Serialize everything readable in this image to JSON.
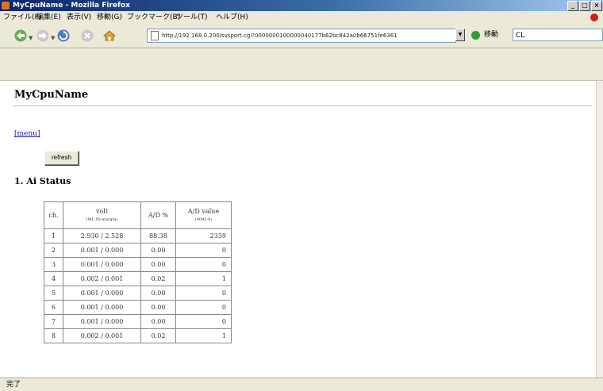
{
  "window": {
    "title": "MyCpuName - Mozilla Firefox"
  },
  "menu": [
    "ファイル(F)",
    "編集(E)",
    "表示(V)",
    "移動(G)",
    "ブックマーク(B)",
    "ツール(T)",
    "ヘルプ(H)"
  ],
  "nav": {
    "url": "http://192.168.0.200/svsport.cgi?0000000100000040177b62bc842a0b66751fe6361",
    "go_label": "移動",
    "search_value": "CL"
  },
  "page": {
    "title": "MyCpuName",
    "menu_link": "[menu]",
    "refresh_label": "refresh",
    "section_heading": "1. Ai Status",
    "table": {
      "headers": {
        "ch": "ch.",
        "volt": "volt",
        "volt_sub": "(ML Ni-margin)",
        "ad_pct": "A/D %",
        "ad_value": "A/D value",
        "ad_value_sub": "(4095-0)"
      },
      "rows": [
        {
          "ch": "1",
          "volt": "2.930 / 2.528",
          "ad_pct": "88.38",
          "ad_value": "2359"
        },
        {
          "ch": "2",
          "volt": "0.001 / 0.000",
          "ad_pct": "0.00",
          "ad_value": "0"
        },
        {
          "ch": "3",
          "volt": "0.001 / 0.000",
          "ad_pct": "0.00",
          "ad_value": "0"
        },
        {
          "ch": "4",
          "volt": "0.002 / 0.001",
          "ad_pct": "0.02",
          "ad_value": "1"
        },
        {
          "ch": "5",
          "volt": "0.001 / 0.000",
          "ad_pct": "0.00",
          "ad_value": "0"
        },
        {
          "ch": "6",
          "volt": "0.001 / 0.000",
          "ad_pct": "0.00",
          "ad_value": "0"
        },
        {
          "ch": "7",
          "volt": "0.001 / 0.000",
          "ad_pct": "0.00",
          "ad_value": "0"
        },
        {
          "ch": "8",
          "volt": "0.002 / 0.001",
          "ad_pct": "0.02",
          "ad_value": "1"
        }
      ]
    }
  },
  "status": {
    "text": "完了"
  }
}
